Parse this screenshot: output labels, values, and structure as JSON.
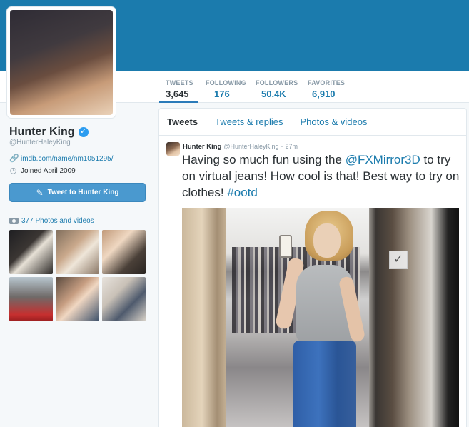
{
  "profile": {
    "name": "Hunter King",
    "handle": "@HunterHaleyKing",
    "website": "imdb.com/name/nm1051295/",
    "joined": "Joined April 2009",
    "tweet_to_button": "Tweet to Hunter King",
    "photos_videos_link": "377 Photos and videos"
  },
  "stats": [
    {
      "label": "TWEETS",
      "value": "3,645"
    },
    {
      "label": "FOLLOWING",
      "value": "176"
    },
    {
      "label": "FOLLOWERS",
      "value": "50.4K"
    },
    {
      "label": "FAVORITES",
      "value": "6,910"
    }
  ],
  "tabs": [
    "Tweets",
    "Tweets & replies",
    "Photos & videos"
  ],
  "tweet": {
    "author_name": "Hunter King",
    "author_handle": "@HunterHaleyKing",
    "separator": "·",
    "time": "27m",
    "text_part1": "Having so much fun using the ",
    "mention": "@FXMirror3D",
    "text_part2": " to try on virtual jeans! How cool is that! Best way to try on clothes! ",
    "hashtag": "#ootd"
  },
  "icons": {
    "verified": "verified-badge-icon",
    "link": "link-icon",
    "calendar": "calendar-icon",
    "compose": "compose-icon",
    "camera": "camera-icon"
  },
  "colors": {
    "header": "#1b7bad",
    "link": "#1b7bad",
    "button": "#4a99cf"
  }
}
